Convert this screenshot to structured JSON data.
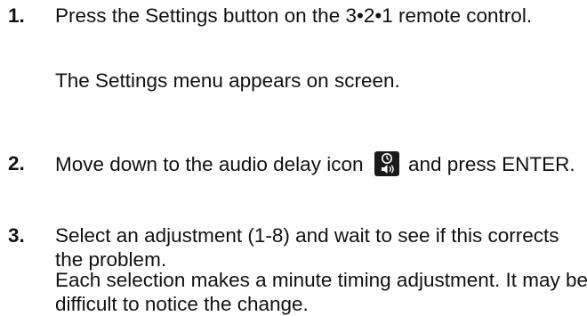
{
  "steps": [
    {
      "number": "1.",
      "text": "Press the Settings button on the 3•2•1 remote control.",
      "note": "The Settings menu appears on screen."
    },
    {
      "number": "2.",
      "text_before_icon": "Move down to the audio delay icon",
      "icon": "audio-delay-icon",
      "text_after_icon": "and press ENTER."
    },
    {
      "number": "3.",
      "text": "Select an adjustment (1-8) and wait to see if this corrects the problem.",
      "note": "Each selection makes a minute timing adjustment. It may be difficult to notice the change."
    }
  ]
}
